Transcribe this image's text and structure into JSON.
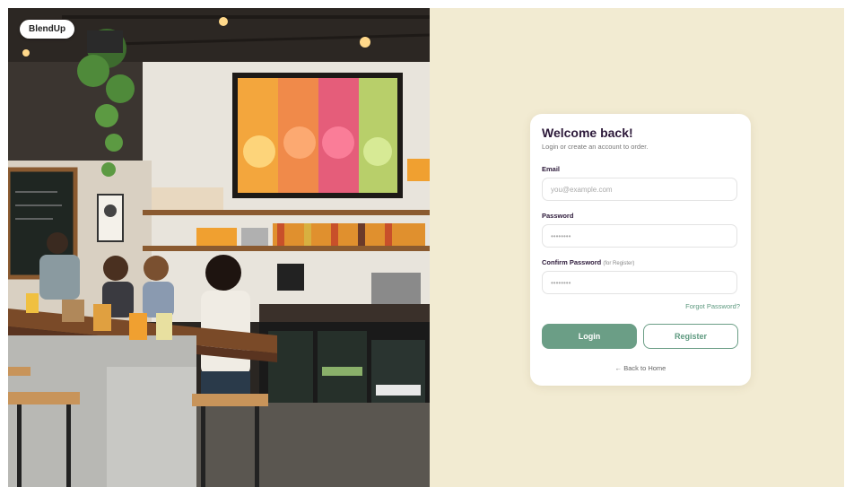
{
  "brand": {
    "name": "BlendUp"
  },
  "login_card": {
    "title": "Welcome back!",
    "subtitle": "Login or create an account to order.",
    "email": {
      "label": "Email",
      "placeholder": "you@example.com"
    },
    "password": {
      "label": "Password",
      "value": "••••••••"
    },
    "confirm_password": {
      "label": "Confirm Password",
      "hint": "(for Register)",
      "value": "••••••••"
    },
    "forgot_link": "Forgot Password?",
    "login_button": "Login",
    "register_button": "Register",
    "back_link": "← Back to Home"
  },
  "colors": {
    "panel_bg": "#f2ebd2",
    "accent": "#6b9e86",
    "title": "#2d1a3a"
  }
}
